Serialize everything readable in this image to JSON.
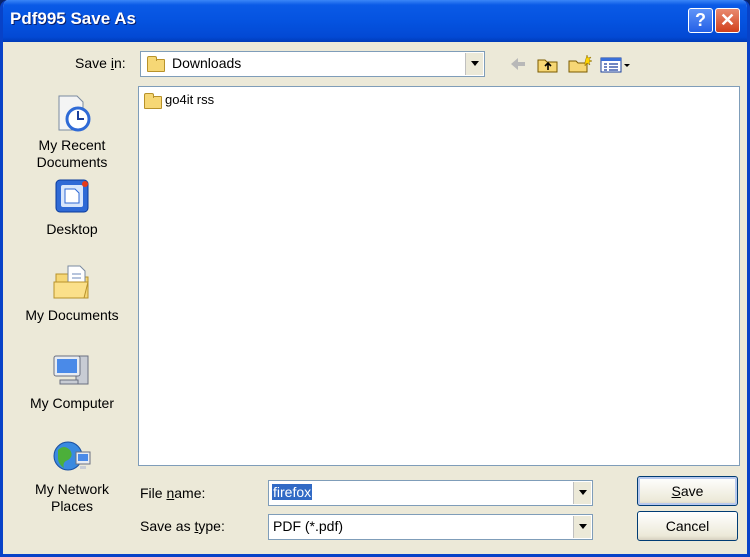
{
  "window": {
    "title": "Pdf995 Save As"
  },
  "titlebar_buttons": {
    "help": "?",
    "close": "✕"
  },
  "save_in": {
    "label_pre": "Save ",
    "label_key": "i",
    "label_post": "n:",
    "value": "Downloads"
  },
  "toolbar": [
    "back-icon",
    "up-folder-icon",
    "new-folder-icon",
    "views-menu-icon"
  ],
  "places": [
    {
      "label": "My Recent Documents",
      "icon": "recent-documents-icon"
    },
    {
      "label": "Desktop",
      "icon": "desktop-icon"
    },
    {
      "label": "My Documents",
      "icon": "my-documents-icon"
    },
    {
      "label": "My Computer",
      "icon": "my-computer-icon"
    },
    {
      "label": "My Network Places",
      "icon": "network-places-icon"
    }
  ],
  "files": [
    {
      "name": "go4it rss",
      "type": "folder"
    }
  ],
  "file_name": {
    "label_pre": "File ",
    "label_key": "n",
    "label_post": "ame:",
    "value": "firefox"
  },
  "save_as_type": {
    "label_pre": "Save as ",
    "label_key": "t",
    "label_post": "ype:",
    "value": "PDF (*.pdf)"
  },
  "buttons": {
    "save": {
      "key": "S",
      "rest": "ave"
    },
    "cancel": "Cancel"
  },
  "colors": {
    "title_bar": "#0553e0",
    "face": "#ece9d8",
    "selection": "#316ac5",
    "close": "#d1401c"
  }
}
